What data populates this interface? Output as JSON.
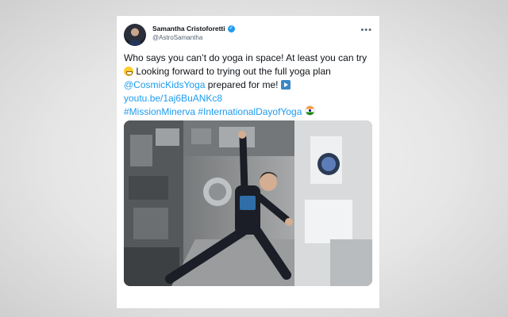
{
  "tweet": {
    "author": {
      "name": "Samantha Cristoforetti",
      "handle": "@AstroSamantha",
      "verified": true,
      "avatar": "avatar-icon"
    },
    "more_icon": "more-horizontal-icon",
    "text": {
      "part1": "Who says you can’t do yoga in space! At least you can try ",
      "emoji1": "grinning-face-icon",
      "part2": " Looking forward to trying out the full yoga plan ",
      "mention": "@CosmicKidsYoga",
      "part3": " prepared for me! ",
      "emoji2": "play-button-icon",
      "link": "youtu.be/1aj6BuANKc8",
      "hashtag1": "#MissionMinerva",
      "hashtag2": "#InternationalDayofYoga",
      "emoji3": "india-flag-icon"
    },
    "media": {
      "description_icon": "space-station-photo"
    }
  },
  "colors": {
    "link": "#1d9bf0",
    "text": "#0f1419",
    "secondary": "#536471",
    "verified": "#1d9bf0"
  }
}
